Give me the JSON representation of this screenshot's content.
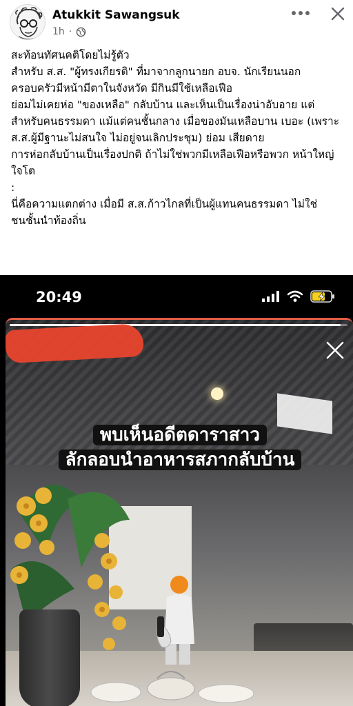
{
  "post": {
    "author": "Atukkit Sawangsuk",
    "time": "1h",
    "privacy_icon": "globe-icon",
    "more_icon": "more-horizontal-icon",
    "close_icon": "close-icon",
    "paragraphs": [
      "สะท้อนทัศนคติโดยไม่รู้ตัว",
      "สำหรับ ส.ส. \"ผู้ทรงเกียรติ\" ที่มาจากลูกนายก อบจ. นักเรียนนอก ครอบครัวมีหน้ามีตาในจังหวัด มีกินมีใช้เหลือเฟือ",
      "ย่อมไม่เคยห่อ \"ของเหลือ\" กลับบ้าน และเห็นเป็นเรื่องน่าอับอาย แต่สำหรับคนธรรมดา แม้แต่คนชั้นกลาง เมื่อของมันเหลือบาน เบอะ (เพราะ ส.ส.ผู้มีฐานะไม่สนใจ ไม่อยู่จนเลิกประชุม) ย่อม เสียดาย",
      "การห่อกลับบ้านเป็นเรื่องปกติ ถ้าไม่ใช่พวกมีเหลือเฟือหรือพวก หน้าใหญ่ใจโต",
      ":",
      "นี่คือความแตกต่าง เมื่อมี ส.ส.ก้าวไกลที่เป็นผู้แทนคนธรรมดา ไม่ใช่ชนชั้นนำท้องถิ่น"
    ]
  },
  "screenshot": {
    "status_time": "20:49",
    "status_icons": [
      "signal-icon",
      "wifi-icon",
      "battery-charging-icon"
    ],
    "story_progress": 0.98,
    "headline_line1": "พบเห็นอดีตดาราสาว",
    "headline_line2": "ลักลอบนำอาหารสภากลับบ้าน",
    "story_close_icon": "close-icon",
    "accent_color": "#e45c46"
  }
}
